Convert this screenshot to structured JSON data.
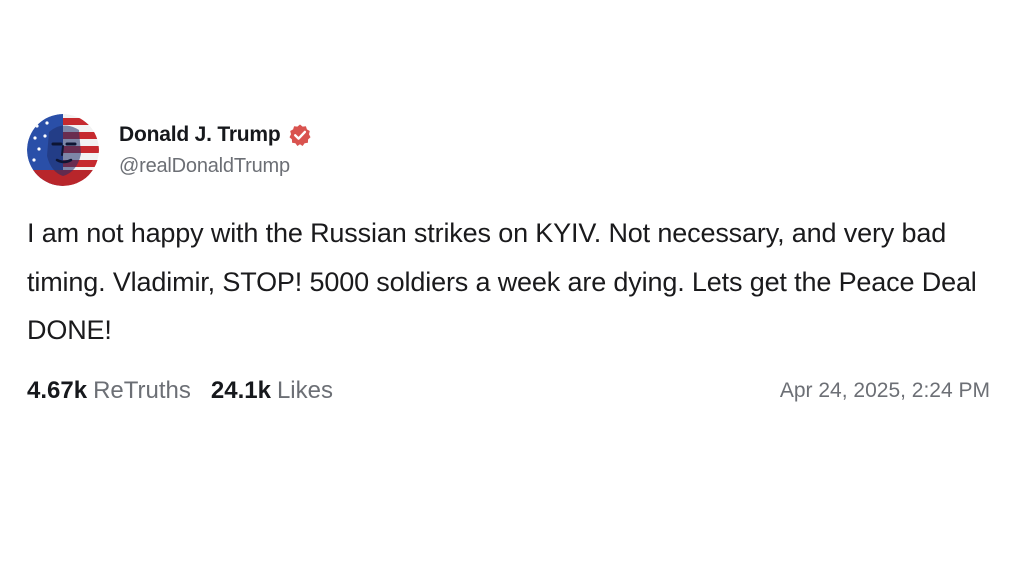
{
  "post": {
    "author": {
      "display_name": "Donald J. Trump",
      "handle": "@realDonaldTrump",
      "verified_icon": "verified-check-icon",
      "verified_color": "#d9534f"
    },
    "text": "I am not happy with the Russian strikes on KYIV. Not necessary, and very bad timing. Vladimir, STOP! 5000 soldiers a week are dying. Lets get the Peace Deal DONE!",
    "stats": {
      "retruths_count": "4.67k",
      "retruths_label": "ReTruths",
      "likes_count": "24.1k",
      "likes_label": "Likes"
    },
    "timestamp": "Apr 24, 2025, 2:24 PM"
  },
  "colors": {
    "background": "#ffffff",
    "primary_text": "#16181c",
    "secondary_text": "#6c6f75",
    "accent": "#d9534f"
  }
}
